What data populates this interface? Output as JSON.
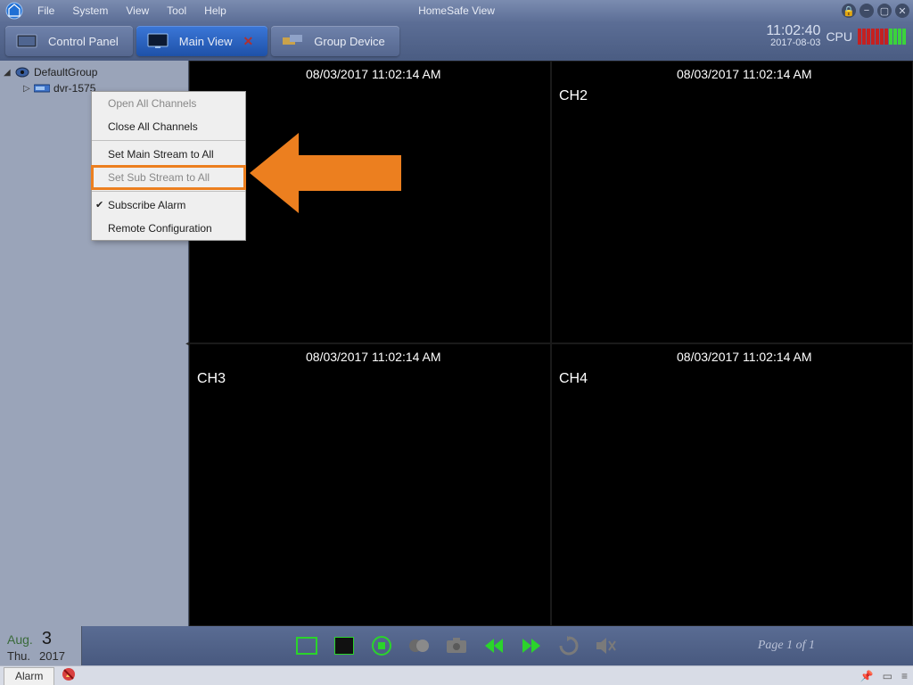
{
  "app": {
    "title": "HomeSafe View"
  },
  "menu": {
    "file": "File",
    "system": "System",
    "view": "View",
    "tool": "Tool",
    "help": "Help"
  },
  "tabs": {
    "control_panel": "Control Panel",
    "main_view": "Main View",
    "group_device": "Group Device"
  },
  "clock": {
    "time": "11:02:40",
    "date": "2017-08-03",
    "cpu_label": "CPU"
  },
  "tree": {
    "group": "DefaultGroup",
    "device": "dvr-1575"
  },
  "context_menu": {
    "open_all": "Open All Channels",
    "close_all": "Close All Channels",
    "set_main": "Set Main Stream to All",
    "set_sub": "Set Sub Stream to All",
    "subscribe": "Subscribe Alarm",
    "remote_cfg": "Remote Configuration"
  },
  "cells": {
    "ts1": "08/03/2017 11:02:14 AM",
    "ts2": "08/03/2017 11:02:14 AM",
    "ch2": "CH2",
    "ts3": "08/03/2017 11:02:14 AM",
    "ch3": "CH3",
    "ts4": "08/03/2017 11:02:14 AM",
    "ch4": "CH4"
  },
  "bottom": {
    "month": "Aug.",
    "daynum": "3",
    "weekday": "Thu.",
    "year": "2017",
    "page_info": "Page 1 of 1"
  },
  "status": {
    "alarm": "Alarm"
  }
}
